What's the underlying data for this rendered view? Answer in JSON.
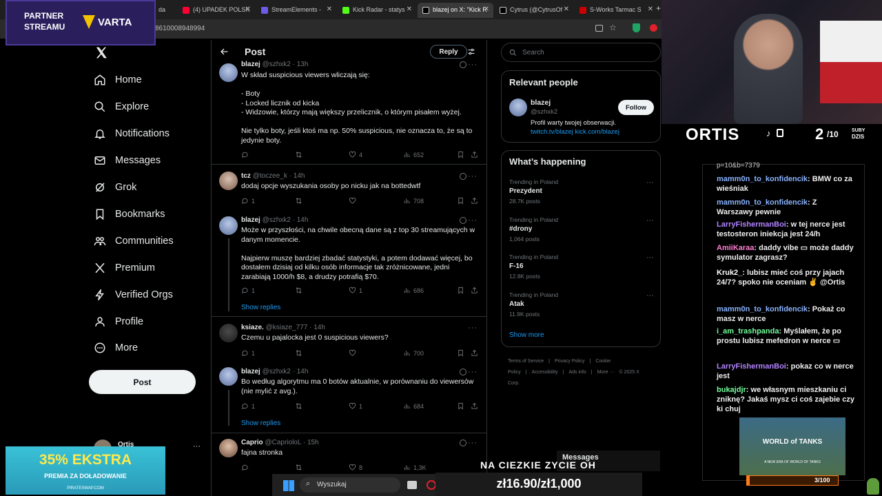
{
  "browser": {
    "tabs": [
      {
        "label": "da",
        "color": "#888888"
      },
      {
        "label": "(4) UPADEK POLSK",
        "color": "#ff0033"
      },
      {
        "label": "StreamElements -",
        "color": "#6c5ce7"
      },
      {
        "label": "Kick Radar - statys",
        "color": "#53fc18"
      },
      {
        "label": "blazej on X: \"Kick R",
        "color": "#000000"
      },
      {
        "label": "Cytrus (@CytrusOf",
        "color": "#000000"
      },
      {
        "label": "S-Works Tarmac S",
        "color": "#cc0000"
      }
    ],
    "url": "8610008948994"
  },
  "nav": {
    "items": [
      {
        "label": "Home",
        "icon": "home-icon"
      },
      {
        "label": "Explore",
        "icon": "search-icon"
      },
      {
        "label": "Notifications",
        "icon": "bell-icon"
      },
      {
        "label": "Messages",
        "icon": "envelope-icon"
      },
      {
        "label": "Grok",
        "icon": "grok-icon"
      },
      {
        "label": "Bookmarks",
        "icon": "bookmark-icon"
      },
      {
        "label": "Communities",
        "icon": "people-icon"
      },
      {
        "label": "Premium",
        "icon": "x-logo-icon"
      },
      {
        "label": "Verified Orgs",
        "icon": "lightning-icon"
      },
      {
        "label": "Profile",
        "icon": "person-icon"
      },
      {
        "label": "More",
        "icon": "more-circle-icon"
      }
    ],
    "post_label": "Post",
    "profile_name": "Ortis"
  },
  "header": {
    "title": "Post",
    "reply_label": "Reply"
  },
  "tweets": [
    {
      "name": "blazej",
      "handle": "@szhxk2",
      "time": "13h",
      "text": "W skład suspicious viewers wliczają się:\n\n- Boty\n- Locked licznik od kicka\n- Widzowie, którzy mają większy przelicznik, o którym pisałem wyżej.\n\nNie tylko boty, jeśli ktoś ma np. 50% suspicious, nie oznacza to, że są to jedynie boty.",
      "replies": "",
      "reposts": "",
      "likes": "4",
      "views": "652"
    },
    {
      "name": "tcz",
      "handle": "@toczee_k",
      "time": "14h",
      "text": "dodaj opcje wyszukania osoby po nicku jak na bottedwtf",
      "replies": "1",
      "reposts": "",
      "likes": "",
      "views": "708"
    },
    {
      "name": "blazej",
      "handle": "@szhxk2",
      "time": "14h",
      "text": "Może w przyszłości, na chwile obecną dane są z top 30 streamujących w danym momencie.\n\nNajpierw muszę bardziej zbadać statystyki, a potem dodawać więcej, bo dostałem dzisiaj od kilku osób informacje tak zróżnicowane, jedni zarabiają 1000/h $8, a drudzy potrafią $70.",
      "replies": "1",
      "reposts": "",
      "likes": "1",
      "views": "686"
    },
    {
      "name": "ksiaze.",
      "handle": "@ksiaze_777",
      "time": "14h",
      "text": "Czemu u pajalocka jest 0 suspicious viewers?",
      "replies": "1",
      "reposts": "",
      "likes": "",
      "views": "700"
    },
    {
      "name": "blazej",
      "handle": "@szhxk2",
      "time": "14h",
      "text": "Bo według algorytmu ma 0 botów aktualnie, w porównaniu do viewersów (nie mylić z avg.).",
      "replies": "1",
      "reposts": "",
      "likes": "1",
      "views": "684"
    },
    {
      "name": "Caprio",
      "handle": "@CaprioloL",
      "time": "15h",
      "text": "fajna stronka",
      "replies": "",
      "reposts": "",
      "likes": "8",
      "views": "1,3K"
    }
  ],
  "show_replies": "Show replies",
  "sidebar": {
    "search_placeholder": "Search",
    "relevant_title": "Relevant people",
    "person": {
      "name": "blazej",
      "handle": "@szhxk2",
      "follow": "Follow",
      "bio": "Profil warty twojej obserwacji.",
      "links": "twitch.tv/blazej kick.com/blazej"
    },
    "happening_title": "What’s happening",
    "trends": [
      {
        "category": "Trending in Poland",
        "name": "Prezydent",
        "count": "28.7K posts"
      },
      {
        "category": "Trending in Poland",
        "name": "#drony",
        "count": "1,064 posts"
      },
      {
        "category": "Trending in Poland",
        "name": "F-16",
        "count": "12.8K posts"
      },
      {
        "category": "Trending in Poland",
        "name": "Atak",
        "count": "11.9K posts"
      }
    ],
    "show_more": "Show more",
    "footer": [
      "Terms of Service",
      "|",
      "Privacy Policy",
      "|",
      "Cookie Policy",
      "|",
      "Accessibility",
      "|",
      "Ads info",
      "|",
      "More ···",
      "© 2025 X Corp."
    ]
  },
  "stream": {
    "partner_line1": "PARTNER",
    "partner_line2": "STREAMU",
    "varta": "VARTA",
    "streamer": "ORTIS",
    "subs_count": "2",
    "subs_goal": "/10",
    "subs_label1": "SUBY",
    "subs_label2": "DZIS",
    "chat_top": "p=10&b=7379",
    "chat": [
      {
        "user": "mamm0n_to_konfidencik",
        "color": "#8ab4ff",
        "text": "BMW co za wieśniak"
      },
      {
        "user": "mamm0n_to_konfidencik",
        "color": "#8ab4ff",
        "text": "Z Warszawy pewnie"
      },
      {
        "user": "LarryFishermanBoi",
        "color": "#b283ff",
        "text": "w tej nerce jest testosteron iniekcja jest 24/h"
      },
      {
        "user": "AmiiKaraa",
        "color": "#ff7fd1",
        "text": "daddy vibe ▭ może daddy symulator zagrasz?"
      },
      {
        "user": "Kruk2_",
        "color": "#ffffff",
        "text": "lubisz mieć coś przy jajach 24/7? spoko nie oceniam ✌ @Ortis"
      },
      {
        "user": "mamm0n_to_konfidencik",
        "color": "#8ab4ff",
        "text": "Pokaż co masz w nerce"
      },
      {
        "user": "i_am_trashpanda",
        "color": "#73ff9c",
        "text": "Myślałem, że po prostu lubisz mefedron w nerce ▭"
      },
      {
        "user": "LarryFishermanBoi",
        "color": "#b283ff",
        "text": "pokaz co w nerce jest"
      },
      {
        "user": "bukajdjr",
        "color": "#73ff9c",
        "text": "we własnym mieszkaniu ci zniknę? Jakaś mysz ci coś zajebie czy ki chuj"
      }
    ],
    "wot_title": "WORLD of TANKS",
    "wot_sub": "A NEW ERA OF WORLD OF TANKS",
    "wot_progress": "3/100",
    "promo_big": "35% EKSTRA",
    "promo_small": "PREMIA ZA DOŁADOWANIE",
    "promo_site": "PIRATESWAP.COM",
    "ticker_title": "NA CIEZKIE ZYCIE OH",
    "ticker_value": "zł16.90/zł1,000",
    "messages": "Messages",
    "taskbar_search": "Wyszukaj"
  }
}
